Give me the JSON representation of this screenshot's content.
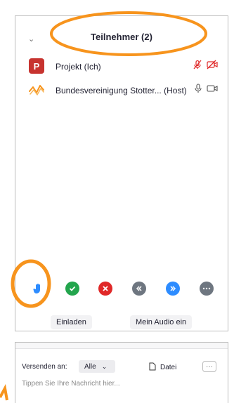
{
  "participants_panel": {
    "title": "Teilnehmer (2)",
    "participants": [
      {
        "avatar_letter": "P",
        "name": "Projekt (Ich)",
        "mic": "mic-muted-icon",
        "video": "video-off-icon"
      },
      {
        "avatar": "logo-icon",
        "name": "Bundesvereinigung Stotter... (Host)",
        "mic": "mic-icon",
        "video": "video-icon"
      }
    ],
    "reactions": [
      {
        "icon": "raise-hand-icon",
        "color": "#2d8cff"
      },
      {
        "icon": "check-icon",
        "color": "#23a54d"
      },
      {
        "icon": "x-icon",
        "color": "#e02828"
      },
      {
        "icon": "slower-icon",
        "color": "#6e7680"
      },
      {
        "icon": "faster-icon",
        "color": "#2d8cff"
      },
      {
        "icon": "more-icon",
        "color": "#6e7680"
      }
    ],
    "buttons": {
      "invite": "Einladen",
      "audio": "Mein Audio ein"
    }
  },
  "chat": {
    "send_to_label": "Versenden an:",
    "recipient": "Alle",
    "file_label": "Datei",
    "more_label": "···",
    "input_placeholder": "Tippen Sie Ihre Nachricht hier...",
    "input_value": ""
  },
  "colors": {
    "accent": "#2d8cff",
    "avatar_red": "#c7332f",
    "muted_red": "#e02828",
    "annotation_orange": "#f7941d"
  }
}
